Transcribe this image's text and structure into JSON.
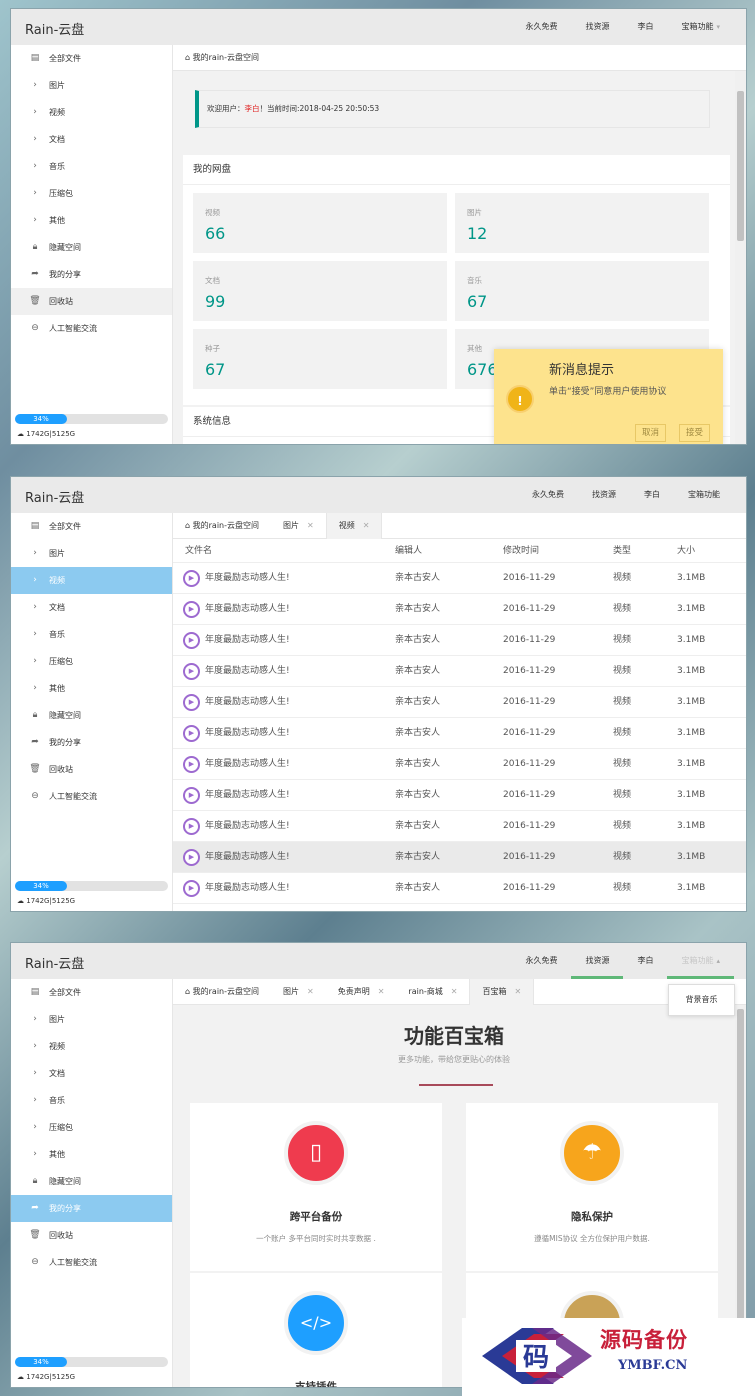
{
  "app": {
    "brand": "Rain-云盘"
  },
  "nav": [
    {
      "label": "永久免费"
    },
    {
      "label": "找资源"
    },
    {
      "label": "李白"
    },
    {
      "label": "宝箱功能"
    }
  ],
  "sidebar": {
    "items": [
      {
        "label": "全部文件",
        "icon": "file-icon"
      },
      {
        "label": "图片",
        "icon": "chevron-right-icon"
      },
      {
        "label": "视频",
        "icon": "chevron-right-icon"
      },
      {
        "label": "文档",
        "icon": "chevron-right-icon"
      },
      {
        "label": "音乐",
        "icon": "chevron-right-icon"
      },
      {
        "label": "压缩包",
        "icon": "chevron-right-icon"
      },
      {
        "label": "其他",
        "icon": "chevron-right-icon"
      },
      {
        "label": "隐藏空间",
        "icon": "lock-icon"
      },
      {
        "label": "我的分享",
        "icon": "share-icon"
      },
      {
        "label": "回收站",
        "icon": "trash-icon"
      },
      {
        "label": "人工智能交流",
        "icon": "chat-icon"
      }
    ],
    "usage_label": "34%",
    "usage_fraction": 0.34,
    "quota": "1742G|5125G"
  },
  "screen1": {
    "breadcrumb": "我的rain-云盘空间",
    "welcome": {
      "prefix": "欢迎用户：",
      "user": "李白",
      "suffix": "！当前时间:2018-04-25 20:50:53"
    },
    "disk_title": "我的网盘",
    "stats": [
      {
        "label": "视频",
        "value": "66"
      },
      {
        "label": "图片",
        "value": "12"
      },
      {
        "label": "文档",
        "value": "99"
      },
      {
        "label": "音乐",
        "value": "67"
      },
      {
        "label": "种子",
        "value": "67"
      },
      {
        "label": "其他",
        "value": "676"
      }
    ],
    "system_title": "系统信息",
    "toast": {
      "title": "新消息提示",
      "message": "单击“接受”同意用户使用协议",
      "cancel": "取消",
      "accept": "接受"
    }
  },
  "screen2": {
    "tabs": [
      {
        "label": "我的rain-云盘空间",
        "closable": false
      },
      {
        "label": "图片",
        "closable": true
      },
      {
        "label": "视频",
        "closable": true
      }
    ],
    "columns": [
      "文件名",
      "编辑人",
      "修改时间",
      "类型",
      "大小"
    ],
    "rows": [
      {
        "name": "年度最励志动感人生!",
        "editor": "亲本古安人",
        "date": "2016-11-29",
        "type": "视频",
        "size": "3.1MB"
      },
      {
        "name": "年度最励志动感人生!",
        "editor": "亲本古安人",
        "date": "2016-11-29",
        "type": "视频",
        "size": "3.1MB"
      },
      {
        "name": "年度最励志动感人生!",
        "editor": "亲本古安人",
        "date": "2016-11-29",
        "type": "视频",
        "size": "3.1MB"
      },
      {
        "name": "年度最励志动感人生!",
        "editor": "亲本古安人",
        "date": "2016-11-29",
        "type": "视频",
        "size": "3.1MB"
      },
      {
        "name": "年度最励志动感人生!",
        "editor": "亲本古安人",
        "date": "2016-11-29",
        "type": "视频",
        "size": "3.1MB"
      },
      {
        "name": "年度最励志动感人生!",
        "editor": "亲本古安人",
        "date": "2016-11-29",
        "type": "视频",
        "size": "3.1MB"
      },
      {
        "name": "年度最励志动感人生!",
        "editor": "亲本古安人",
        "date": "2016-11-29",
        "type": "视频",
        "size": "3.1MB"
      },
      {
        "name": "年度最励志动感人生!",
        "editor": "亲本古安人",
        "date": "2016-11-29",
        "type": "视频",
        "size": "3.1MB"
      },
      {
        "name": "年度最励志动感人生!",
        "editor": "亲本古安人",
        "date": "2016-11-29",
        "type": "视频",
        "size": "3.1MB"
      },
      {
        "name": "年度最励志动感人生!",
        "editor": "亲本古安人",
        "date": "2016-11-29",
        "type": "视频",
        "size": "3.1MB"
      },
      {
        "name": "年度最励志动感人生!",
        "editor": "亲本古安人",
        "date": "2016-11-29",
        "type": "视频",
        "size": "3.1MB"
      }
    ]
  },
  "screen3": {
    "tabs": [
      {
        "label": "我的rain-云盘空间",
        "closable": false
      },
      {
        "label": "图片",
        "closable": true
      },
      {
        "label": "免责声明",
        "closable": true
      },
      {
        "label": "rain-商城",
        "closable": true
      },
      {
        "label": "百宝箱",
        "closable": true
      }
    ],
    "dropdown_item": "背景音乐",
    "title": "功能百宝箱",
    "subtitle": "更多功能，带给您更贴心的体验",
    "features": [
      {
        "title": "跨平台备份",
        "desc": "一个账户 多平台同时实时共享数据 .",
        "icon": "mobile-icon",
        "color": "#ef3b4e"
      },
      {
        "title": "隐私保护",
        "desc": "遵循MIS协议 全方位保护用户数据.",
        "icon": "umbrella-icon",
        "color": "#f7a51c"
      },
      {
        "title": "支持插件",
        "desc": "",
        "icon": "code-icon",
        "color": "#1e9fff"
      },
      {
        "title": "",
        "desc": "",
        "icon": "feature-icon",
        "color": "#c9a257"
      }
    ]
  },
  "watermark": {
    "cn": "源码备份",
    "en": "YMBF.CN",
    "glyph": "码"
  }
}
